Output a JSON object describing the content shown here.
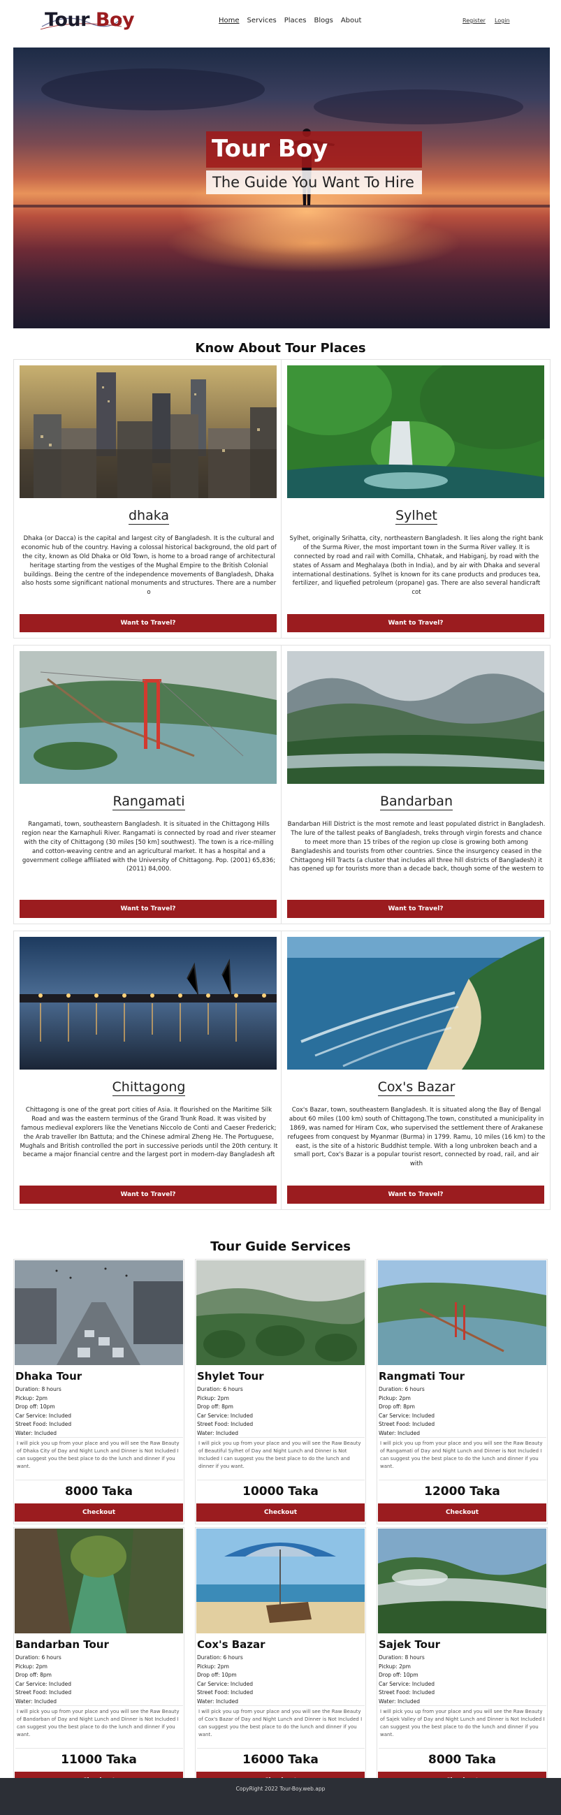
{
  "brand": {
    "logo_part1": "Tour",
    "logo_part2": "Boy"
  },
  "nav": {
    "links": [
      "Home",
      "Services",
      "Places",
      "Blogs",
      "About"
    ],
    "register": "Register",
    "login": "Login"
  },
  "hero": {
    "title": "Tour Boy",
    "subtitle": "The Guide You Want To Hire"
  },
  "places_section": {
    "title": "Know About Tour Places"
  },
  "places": [
    {
      "name": "dhaka",
      "button": "Want to Travel?",
      "description": "Dhaka (or Dacca) is the capital and largest city of Bangladesh. It is the cultural and economic hub of the country. Having a colossal historical background, the old part of the city, known as Old Dhaka or Old Town, is home to a broad range of architectural heritage starting from the vestiges of the Mughal Empire to the British Colonial buildings. Being the centre of the independence movements of Bangladesh, Dhaka also hosts some significant national monuments and structures. There are a number o"
    },
    {
      "name": "Sylhet",
      "button": "Want to Travel?",
      "description": "Sylhet, originally Srihatta, city, northeastern Bangladesh. It lies along the right bank of the Surma River, the most important town in the Surma River valley. It is connected by road and rail with Comilla, Chhatak, and Habiganj, by road with the states of Assam and Meghalaya (both in India), and by air with Dhaka and several international destinations. Sylhet is known for its cane products and produces tea, fertilizer, and liquefied petroleum (propane) gas. There are also several handicraft cot"
    },
    {
      "name": "Rangamati",
      "button": "Want to Travel?",
      "description": "Rangamati, town, southeastern Bangladesh. It is situated in the Chittagong Hills region near the Karnaphuli River. Rangamati is connected by road and river steamer with the city of Chittagong (30 miles [50 km] southwest). The town is a rice-milling and cotton-weaving centre and an agricultural market. It has a hospital and a government college affiliated with the University of Chittagong. Pop. (2001) 65,836; (2011) 84,000."
    },
    {
      "name": "Bandarban",
      "button": "Want to Travel?",
      "description": "Bandarban Hill District is the most remote and least populated district in Bangladesh. The lure of the tallest peaks of Bangladesh, treks through virgin forests and chance to meet more than 15 tribes of the region up close is growing both among Bangladeshis and tourists from other countries. Since the insurgency ceased in the Chittagong Hill Tracts (a cluster that includes all three hill districts of Bangladesh) it has opened up for tourists more than a decade back, though some of the western to"
    },
    {
      "name": "Chittagong",
      "button": "Want to Travel?",
      "description": "Chittagong is one of the great port cities of Asia. It flourished on the Maritime Silk Road and was the eastern terminus of the Grand Trunk Road. It was visited by famous medieval explorers like the Venetians Niccolo de Conti and Caeser Frederick; the Arab traveller Ibn Battuta; and the Chinese admiral Zheng He. The Portuguese, Mughals and British controlled the port in successive periods until the 20th century. It became a major financial centre and the largest port in modern-day Bangladesh aft"
    },
    {
      "name": "Cox's Bazar",
      "button": "Want to Travel?",
      "description": "Cox's Bazar, town, southeastern Bangladesh. It is situated along the Bay of Bengal about 60 miles (100 km) south of Chittagong.The town, constituted a municipality in 1869, was named for Hiram Cox, who supervised the settlement there of Arakanese refugees from conquest by Myanmar (Burma) in 1799. Ramu, 10 miles (16 km) to the east, is the site of a historic Buddhist temple. With a long unbroken beach and a small port, Cox's Bazar is a popular tourist resort, connected by road, rail, and air with"
    }
  ],
  "guides_section": {
    "title": "Tour Guide Services"
  },
  "guides": [
    {
      "name": "Dhaka Tour",
      "duration": "Duration: 8 hours",
      "pickup": "Pickup: 2pm",
      "dropoff": "Drop off: 10pm",
      "car": "Car Service: Included",
      "food": "Street Food: Included",
      "water": "Water: Included",
      "description": "I will pick you up from your place and you will see the Raw Beauty of Dhaka City of Day and Night Lunch and Dinner is Not Included I can suggest you the best place to do the lunch and dinner if you want.",
      "price": "8000 Taka",
      "button": "Checkout"
    },
    {
      "name": "Shylet Tour",
      "duration": "Duration: 6 hours",
      "pickup": "Pickup: 2pm",
      "dropoff": "Drop off: 8pm",
      "car": "Car Service: Included",
      "food": "Street Food: Included",
      "water": "Water: Included",
      "description": "I will pick you up from your place and you will see the Raw Beauty of Beautiful Sylhet of Day and Night Lunch and Dinner is Not Included I can suggest you the best place to do the lunch and dinner if you want.",
      "price": "10000 Taka",
      "button": "Checkout"
    },
    {
      "name": "Rangmati Tour",
      "duration": "Duration: 6 hours",
      "pickup": "Pickup: 2pm",
      "dropoff": "Drop off: 8pm",
      "car": "Car Service: Included",
      "food": "Street Food: Included",
      "water": "Water: Included",
      "description": "I will pick you up from your place and you will see the Raw Beauty of Rangamati of Day and Night Lunch and Dinner is Not Included I can suggest you the best place to do the lunch and dinner if you want.",
      "price": "12000 Taka",
      "button": "Checkout"
    },
    {
      "name": "Bandarban Tour",
      "duration": "Duration: 6 hours",
      "pickup": "Pickup: 2pm",
      "dropoff": "Drop off: 8pm",
      "car": "Car Service: Included",
      "food": "Street Food: Included",
      "water": "Water: Included",
      "description": "I will pick you up from your place and you will see the Raw Beauty of Bandarban of Day and Night Lunch and Dinner is Not Included I can suggest you the best place to do the lunch and dinner if you want.",
      "price": "11000 Taka",
      "button": "Checkout"
    },
    {
      "name": "Cox's Bazar",
      "duration": "Duration: 6 hours",
      "pickup": "Pickup: 2pm",
      "dropoff": "Drop off: 10pm",
      "car": "Car Service: Included",
      "food": "Street Food: Included",
      "water": "Water: Included",
      "description": "I will pick you up from your place and you will see the Raw Beauty of Cox's Bazar of Day and Night Lunch and Dinner is Not Included I can suggest you the best place to do the lunch and dinner if you want.",
      "price": "16000 Taka",
      "button": "Checkout"
    },
    {
      "name": "Sajek Tour",
      "duration": "Duration: 8 hours",
      "pickup": "Pickup: 2pm",
      "dropoff": "Drop off: 10pm",
      "car": "Car Service: Included",
      "food": "Street Food: Included",
      "water": "Water: Included",
      "description": "I will pick you up from your place and you will see the Raw Beauty of Sajek Valley of Day and Night Lunch and Dinner is Not Included I can suggest you the best place to do the lunch and dinner if you want.",
      "price": "8000 Taka",
      "button": "Checkout"
    }
  ],
  "footer": {
    "text": "CopyRight 2022 Tour-Boy.web.app"
  },
  "colors": {
    "accent": "#9b1c1f",
    "footer_bg": "#2c2f36"
  }
}
